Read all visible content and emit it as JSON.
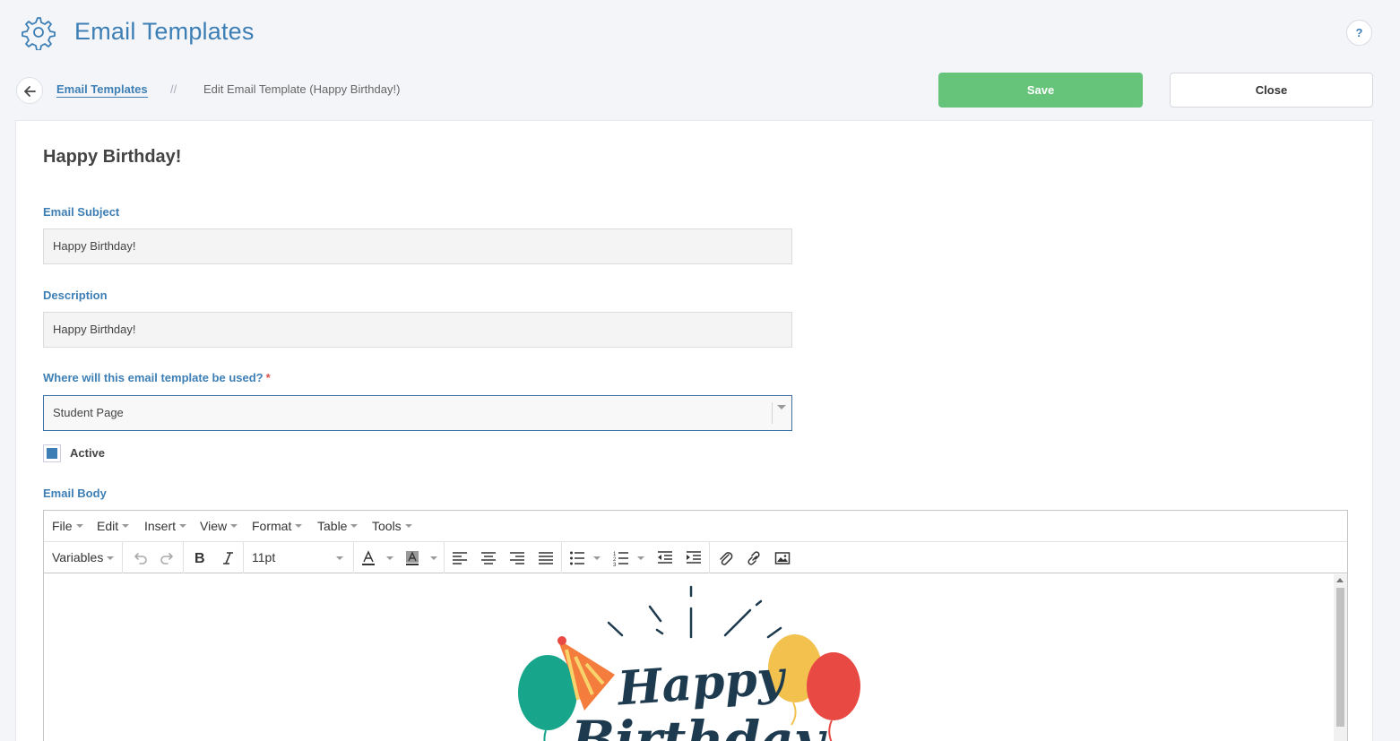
{
  "header": {
    "title": "Email Templates",
    "help_label": "?"
  },
  "breadcrumb": {
    "link_label": "Email Templates",
    "separator": "//",
    "current": "Edit Email Template (Happy Birthday!)"
  },
  "actions": {
    "save_label": "Save",
    "close_label": "Close"
  },
  "form": {
    "template_name": "Happy Birthday!",
    "subject_label": "Email Subject",
    "subject_value": "Happy Birthday!",
    "description_label": "Description",
    "description_value": "Happy Birthday!",
    "usage_label": "Where will this email template be used?",
    "usage_required_mark": "*",
    "usage_value": "Student Page",
    "active_label": "Active",
    "active_checked": true,
    "body_label": "Email Body"
  },
  "editor": {
    "menus": [
      "File",
      "Edit",
      "Insert",
      "View",
      "Format",
      "Table",
      "Tools"
    ],
    "variables_label": "Variables",
    "font_size": "11pt",
    "banner": {
      "line1": "Happy",
      "line2": "Birthday",
      "colors": {
        "text": "#1d3a4f",
        "balloon_green": "#17a58b",
        "balloon_yellow": "#f2c14e",
        "balloon_red": "#e84a43",
        "hat": "#f47c3c"
      }
    }
  },
  "colors": {
    "accent": "#3d7fb5",
    "save_green": "#66c47a",
    "required_red": "#d9534f"
  }
}
